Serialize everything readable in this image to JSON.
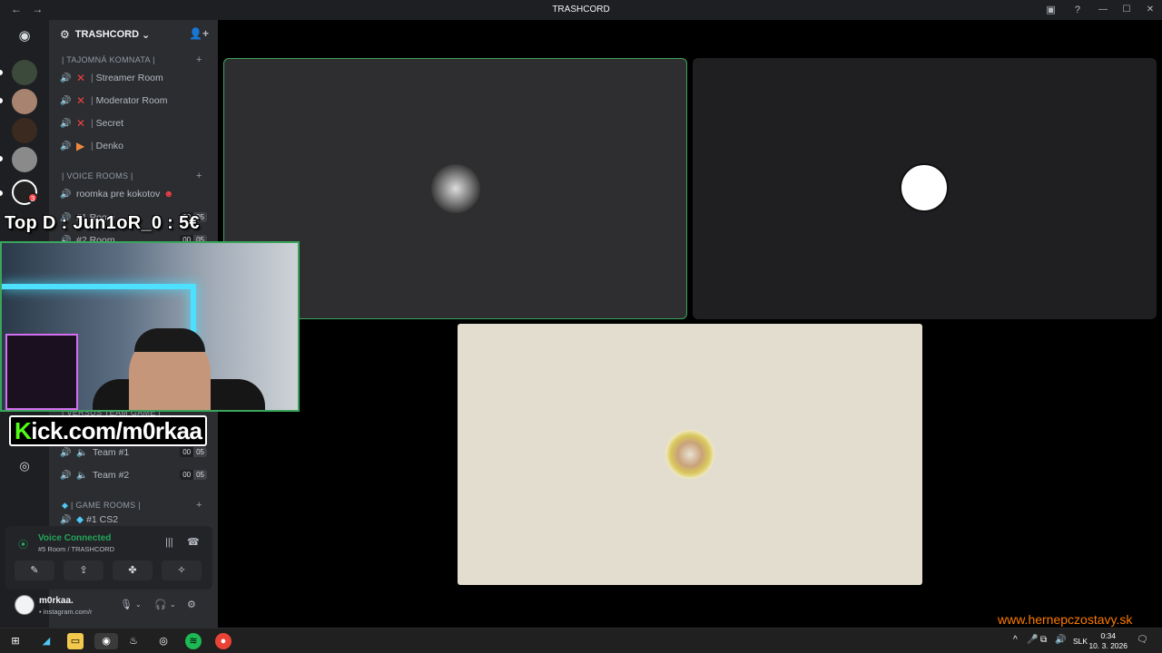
{
  "window": {
    "title": "TRASHCORD",
    "back_icon": "←",
    "forward_icon": "→",
    "inbox_icon": "▣",
    "help_icon": "?",
    "minimize": "—",
    "maximize": "☐",
    "close": "✕"
  },
  "servers": {
    "home_icon": "◉",
    "badge_count": "3",
    "explore_icon": "◎"
  },
  "guild": {
    "name": "TRASHCORD",
    "chevron": "⌄",
    "invite_icon": "👤+"
  },
  "categories": {
    "secret": "| TAJOMNÁ KOMNATA |",
    "voice": "| VOICE ROOMS |",
    "game": "| GAME ROOMS |",
    "team": "| VERSUS TEAM GAME |"
  },
  "channels": {
    "streamer": "Streamer Room",
    "moderator": "Moderator Room",
    "secret": "Secret",
    "denko": "Denko",
    "roomka": "roomka pre kokotov",
    "room1": "#1 Room",
    "room2": "#2 Room",
    "team1": "Team #1",
    "team2": "Team #2",
    "cs2": "#1 CS2",
    "counts": {
      "room1_a": "00",
      "room1_b": "05",
      "room2_a": "00",
      "room2_b": "05",
      "team1_a": "00",
      "team1_b": "05",
      "team2_a": "00",
      "team2_b": "05"
    }
  },
  "voice": {
    "status": "Voice Connected",
    "location": "#5 Room / TRASHCORD",
    "buttons": [
      "✎",
      "⇪",
      "✤",
      "✧"
    ]
  },
  "user": {
    "name": "m0rkaa.",
    "status": "• instagram.com/r"
  },
  "overlay": {
    "top_donation": "Top D : Jun1oR_0 : 5€",
    "kick_prefix": "K",
    "kick_rest": "ick.com/m0rkaa",
    "watermark": "www.hernepczostavy.sk"
  },
  "taskbar": {
    "language": "SLK",
    "time": "0:34",
    "date": "10. 3. 2026"
  }
}
